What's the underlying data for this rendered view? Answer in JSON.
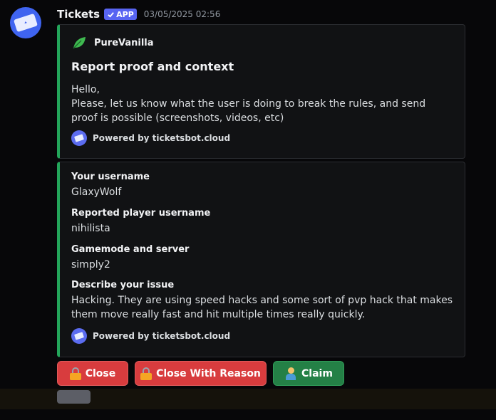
{
  "message": {
    "username": "Tickets",
    "app_badge": "APP",
    "timestamp": "03/05/2025 02:56"
  },
  "embed1": {
    "author": "PureVanilla",
    "title": "Report proof and context",
    "desc_line1": "Hello,",
    "desc_line2": "Please, let us know what the user is doing to break the rules, and send proof is possible (screenshots, videos, etc)",
    "footer": "Powered by ticketsbot.cloud"
  },
  "embed2": {
    "fields": [
      {
        "name": "Your username",
        "value": "GlaxyWolf"
      },
      {
        "name": "Reported player username",
        "value": "nihilista"
      },
      {
        "name": "Gamemode and server",
        "value": "simply2"
      },
      {
        "name": "Describe your issue",
        "value": "Hacking. They are using speed hacks and some sort of pvp hack that makes them move really fast and hit multiple times really quickly."
      }
    ],
    "footer": "Powered by ticketsbot.cloud"
  },
  "buttons": {
    "close": "Close",
    "close_reason": "Close With Reason",
    "claim": "Claim"
  },
  "colors": {
    "embed_accent": "#23a55a",
    "danger": "#d83c3e",
    "success": "#248046",
    "brand": "#5865f2"
  },
  "icons": {
    "avatar": "ticket-icon",
    "author": "leaf-icon",
    "close": "lock-icon",
    "claim": "person-icon"
  }
}
